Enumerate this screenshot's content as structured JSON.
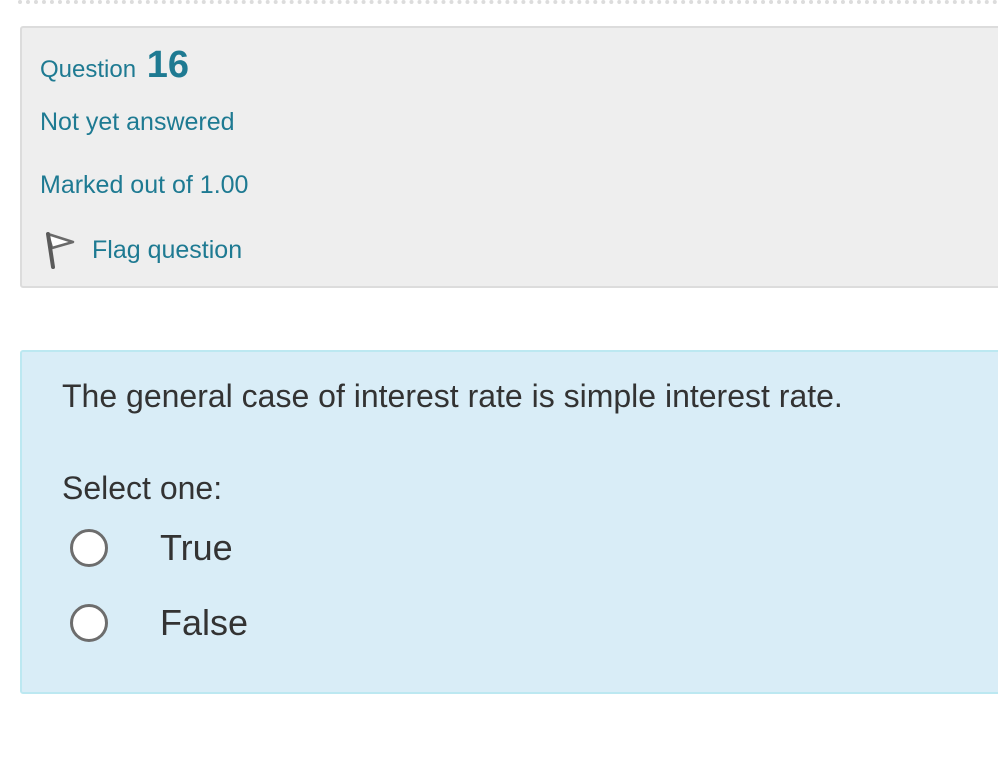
{
  "question_info": {
    "label": "Question",
    "number": "16",
    "state": "Not yet answered",
    "grade": "Marked out of 1.00",
    "flag_label": "Flag question",
    "flag_icon": "flag-icon"
  },
  "question": {
    "text": "The general case of interest rate is simple interest rate.",
    "prompt": "Select one:",
    "options": [
      {
        "label": "True",
        "selected": false
      },
      {
        "label": "False",
        "selected": false
      }
    ]
  },
  "colors": {
    "accent_text": "#1e7a92",
    "info_background": "#eeeeee",
    "content_background": "#d9edf7",
    "content_border": "#bce8f1",
    "body_text": "#333333"
  }
}
